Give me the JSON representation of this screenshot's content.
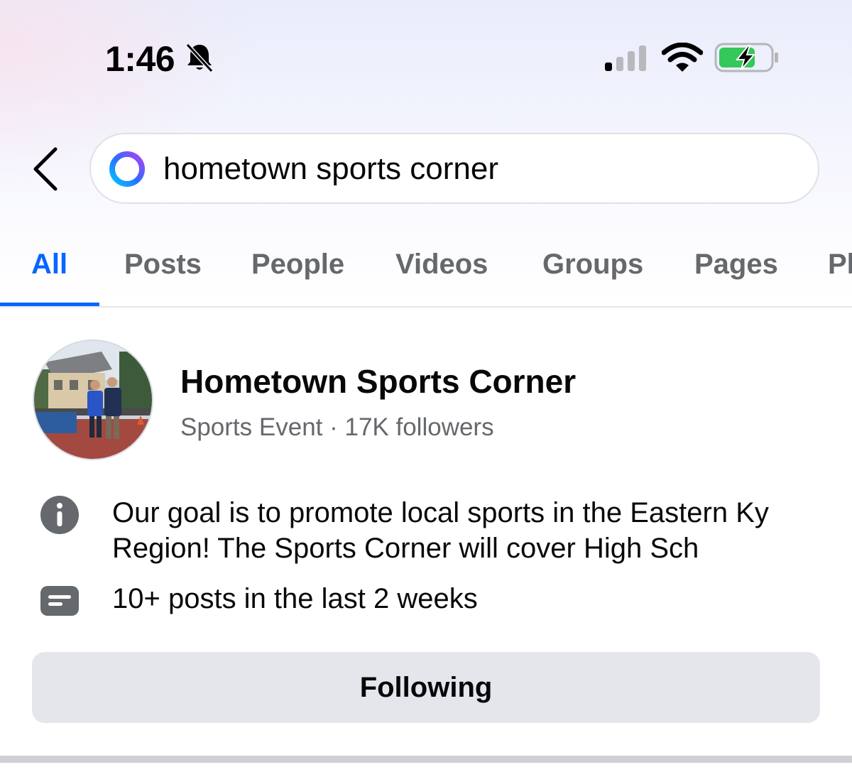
{
  "status_bar": {
    "time": "1:46",
    "icons": [
      "bell-slash-icon",
      "cellular-signal-icon",
      "wifi-icon",
      "battery-charging-icon"
    ]
  },
  "search": {
    "query": "hometown sports corner",
    "icon": "meta-ai-ring-icon"
  },
  "tabs": [
    {
      "label": "All",
      "active": true
    },
    {
      "label": "Posts"
    },
    {
      "label": "People"
    },
    {
      "label": "Videos"
    },
    {
      "label": "Groups"
    },
    {
      "label": "Pages"
    },
    {
      "label": "Pl"
    }
  ],
  "result": {
    "name": "Hometown Sports Corner",
    "meta": "Sports Event · 17K followers",
    "description": "Our goal is to promote local sports in the Eastern Ky Region! The Sports Corner will cover High Sch",
    "activity": "10+ posts in the last 2 weeks",
    "follow_button": "Following"
  },
  "colors": {
    "accent": "#0866ff",
    "secondary_text": "#65686c",
    "button_bg": "#e4e6eb"
  }
}
